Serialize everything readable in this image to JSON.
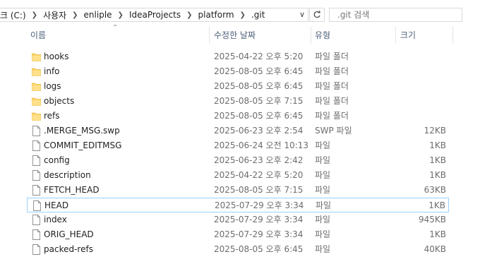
{
  "address": {
    "crumbs": [
      "크 (C:)",
      "사용자",
      "enliple",
      "IdeaProjects",
      "platform",
      ".git"
    ]
  },
  "search": {
    "placeholder": ".git 검색"
  },
  "columns": {
    "name": "이름",
    "date": "수정한 날짜",
    "type": "유형",
    "size": "크기"
  },
  "files": [
    {
      "name": "hooks",
      "date": "2025-04-22 오후 5:20",
      "type": "파일 폴더",
      "size": "",
      "icon": "folder-icon"
    },
    {
      "name": "info",
      "date": "2025-08-05 오후 6:45",
      "type": "파일 폴더",
      "size": "",
      "icon": "folder-icon"
    },
    {
      "name": "logs",
      "date": "2025-08-05 오후 6:45",
      "type": "파일 폴더",
      "size": "",
      "icon": "folder-icon"
    },
    {
      "name": "objects",
      "date": "2025-08-05 오후 7:15",
      "type": "파일 폴더",
      "size": "",
      "icon": "folder-icon"
    },
    {
      "name": "refs",
      "date": "2025-08-05 오후 6:45",
      "type": "파일 폴더",
      "size": "",
      "icon": "folder-icon"
    },
    {
      "name": ".MERGE_MSG.swp",
      "date": "2025-06-23 오후 2:54",
      "type": "SWP 파일",
      "size": "12KB",
      "icon": "file-icon"
    },
    {
      "name": "COMMIT_EDITMSG",
      "date": "2025-06-24 오전 10:13",
      "type": "파일",
      "size": "1KB",
      "icon": "file-icon"
    },
    {
      "name": "config",
      "date": "2025-06-23 오후 2:42",
      "type": "파일",
      "size": "1KB",
      "icon": "file-icon"
    },
    {
      "name": "description",
      "date": "2025-04-22 오후 5:20",
      "type": "파일",
      "size": "1KB",
      "icon": "file-icon"
    },
    {
      "name": "FETCH_HEAD",
      "date": "2025-08-05 오후 7:15",
      "type": "파일",
      "size": "63KB",
      "icon": "file-icon"
    },
    {
      "name": "HEAD",
      "date": "2025-07-29 오후 3:34",
      "type": "파일",
      "size": "1KB",
      "icon": "file-icon",
      "selected": true
    },
    {
      "name": "index",
      "date": "2025-07-29 오후 3:34",
      "type": "파일",
      "size": "945KB",
      "icon": "file-icon"
    },
    {
      "name": "ORIG_HEAD",
      "date": "2025-07-29 오후 3:34",
      "type": "파일",
      "size": "1KB",
      "icon": "file-icon"
    },
    {
      "name": "packed-refs",
      "date": "2025-08-05 오후 6:45",
      "type": "파일",
      "size": "40KB",
      "icon": "file-icon"
    }
  ],
  "colors": {
    "folder": "#ffd66b",
    "folderEdge": "#e8b73c",
    "select": "#99d1ff",
    "header": "#4c607a"
  }
}
